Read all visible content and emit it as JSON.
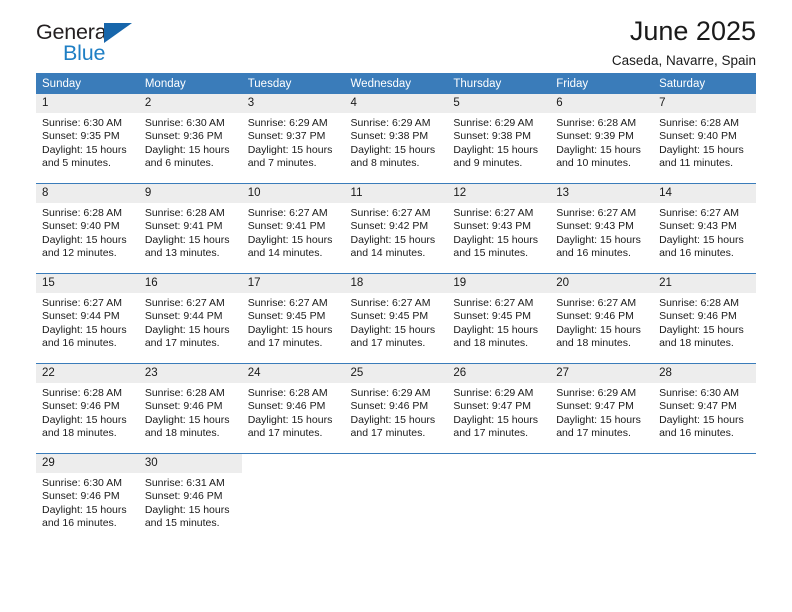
{
  "brand": {
    "name_part1": "General",
    "name_part2": "Blue",
    "triangle_color": "#1766ab",
    "blue_color": "#1f7fc4",
    "dark_color": "#231f20"
  },
  "header": {
    "title": "June 2025",
    "subtitle": "Caseda, Navarre, Spain",
    "accent_color": "#3a7cba",
    "daynum_background": "#ededed"
  },
  "weekday_headers": [
    "Sunday",
    "Monday",
    "Tuesday",
    "Wednesday",
    "Thursday",
    "Friday",
    "Saturday"
  ],
  "weeks": [
    [
      {
        "day": "1",
        "sunrise": "Sunrise: 6:30 AM",
        "sunset": "Sunset: 9:35 PM",
        "daylight_line1": "Daylight: 15 hours",
        "daylight_line2": "and 5 minutes."
      },
      {
        "day": "2",
        "sunrise": "Sunrise: 6:30 AM",
        "sunset": "Sunset: 9:36 PM",
        "daylight_line1": "Daylight: 15 hours",
        "daylight_line2": "and 6 minutes."
      },
      {
        "day": "3",
        "sunrise": "Sunrise: 6:29 AM",
        "sunset": "Sunset: 9:37 PM",
        "daylight_line1": "Daylight: 15 hours",
        "daylight_line2": "and 7 minutes."
      },
      {
        "day": "4",
        "sunrise": "Sunrise: 6:29 AM",
        "sunset": "Sunset: 9:38 PM",
        "daylight_line1": "Daylight: 15 hours",
        "daylight_line2": "and 8 minutes."
      },
      {
        "day": "5",
        "sunrise": "Sunrise: 6:29 AM",
        "sunset": "Sunset: 9:38 PM",
        "daylight_line1": "Daylight: 15 hours",
        "daylight_line2": "and 9 minutes."
      },
      {
        "day": "6",
        "sunrise": "Sunrise: 6:28 AM",
        "sunset": "Sunset: 9:39 PM",
        "daylight_line1": "Daylight: 15 hours",
        "daylight_line2": "and 10 minutes."
      },
      {
        "day": "7",
        "sunrise": "Sunrise: 6:28 AM",
        "sunset": "Sunset: 9:40 PM",
        "daylight_line1": "Daylight: 15 hours",
        "daylight_line2": "and 11 minutes."
      }
    ],
    [
      {
        "day": "8",
        "sunrise": "Sunrise: 6:28 AM",
        "sunset": "Sunset: 9:40 PM",
        "daylight_line1": "Daylight: 15 hours",
        "daylight_line2": "and 12 minutes."
      },
      {
        "day": "9",
        "sunrise": "Sunrise: 6:28 AM",
        "sunset": "Sunset: 9:41 PM",
        "daylight_line1": "Daylight: 15 hours",
        "daylight_line2": "and 13 minutes."
      },
      {
        "day": "10",
        "sunrise": "Sunrise: 6:27 AM",
        "sunset": "Sunset: 9:41 PM",
        "daylight_line1": "Daylight: 15 hours",
        "daylight_line2": "and 14 minutes."
      },
      {
        "day": "11",
        "sunrise": "Sunrise: 6:27 AM",
        "sunset": "Sunset: 9:42 PM",
        "daylight_line1": "Daylight: 15 hours",
        "daylight_line2": "and 14 minutes."
      },
      {
        "day": "12",
        "sunrise": "Sunrise: 6:27 AM",
        "sunset": "Sunset: 9:43 PM",
        "daylight_line1": "Daylight: 15 hours",
        "daylight_line2": "and 15 minutes."
      },
      {
        "day": "13",
        "sunrise": "Sunrise: 6:27 AM",
        "sunset": "Sunset: 9:43 PM",
        "daylight_line1": "Daylight: 15 hours",
        "daylight_line2": "and 16 minutes."
      },
      {
        "day": "14",
        "sunrise": "Sunrise: 6:27 AM",
        "sunset": "Sunset: 9:43 PM",
        "daylight_line1": "Daylight: 15 hours",
        "daylight_line2": "and 16 minutes."
      }
    ],
    [
      {
        "day": "15",
        "sunrise": "Sunrise: 6:27 AM",
        "sunset": "Sunset: 9:44 PM",
        "daylight_line1": "Daylight: 15 hours",
        "daylight_line2": "and 16 minutes."
      },
      {
        "day": "16",
        "sunrise": "Sunrise: 6:27 AM",
        "sunset": "Sunset: 9:44 PM",
        "daylight_line1": "Daylight: 15 hours",
        "daylight_line2": "and 17 minutes."
      },
      {
        "day": "17",
        "sunrise": "Sunrise: 6:27 AM",
        "sunset": "Sunset: 9:45 PM",
        "daylight_line1": "Daylight: 15 hours",
        "daylight_line2": "and 17 minutes."
      },
      {
        "day": "18",
        "sunrise": "Sunrise: 6:27 AM",
        "sunset": "Sunset: 9:45 PM",
        "daylight_line1": "Daylight: 15 hours",
        "daylight_line2": "and 17 minutes."
      },
      {
        "day": "19",
        "sunrise": "Sunrise: 6:27 AM",
        "sunset": "Sunset: 9:45 PM",
        "daylight_line1": "Daylight: 15 hours",
        "daylight_line2": "and 18 minutes."
      },
      {
        "day": "20",
        "sunrise": "Sunrise: 6:27 AM",
        "sunset": "Sunset: 9:46 PM",
        "daylight_line1": "Daylight: 15 hours",
        "daylight_line2": "and 18 minutes."
      },
      {
        "day": "21",
        "sunrise": "Sunrise: 6:28 AM",
        "sunset": "Sunset: 9:46 PM",
        "daylight_line1": "Daylight: 15 hours",
        "daylight_line2": "and 18 minutes."
      }
    ],
    [
      {
        "day": "22",
        "sunrise": "Sunrise: 6:28 AM",
        "sunset": "Sunset: 9:46 PM",
        "daylight_line1": "Daylight: 15 hours",
        "daylight_line2": "and 18 minutes."
      },
      {
        "day": "23",
        "sunrise": "Sunrise: 6:28 AM",
        "sunset": "Sunset: 9:46 PM",
        "daylight_line1": "Daylight: 15 hours",
        "daylight_line2": "and 18 minutes."
      },
      {
        "day": "24",
        "sunrise": "Sunrise: 6:28 AM",
        "sunset": "Sunset: 9:46 PM",
        "daylight_line1": "Daylight: 15 hours",
        "daylight_line2": "and 17 minutes."
      },
      {
        "day": "25",
        "sunrise": "Sunrise: 6:29 AM",
        "sunset": "Sunset: 9:46 PM",
        "daylight_line1": "Daylight: 15 hours",
        "daylight_line2": "and 17 minutes."
      },
      {
        "day": "26",
        "sunrise": "Sunrise: 6:29 AM",
        "sunset": "Sunset: 9:47 PM",
        "daylight_line1": "Daylight: 15 hours",
        "daylight_line2": "and 17 minutes."
      },
      {
        "day": "27",
        "sunrise": "Sunrise: 6:29 AM",
        "sunset": "Sunset: 9:47 PM",
        "daylight_line1": "Daylight: 15 hours",
        "daylight_line2": "and 17 minutes."
      },
      {
        "day": "28",
        "sunrise": "Sunrise: 6:30 AM",
        "sunset": "Sunset: 9:47 PM",
        "daylight_line1": "Daylight: 15 hours",
        "daylight_line2": "and 16 minutes."
      }
    ],
    [
      {
        "day": "29",
        "sunrise": "Sunrise: 6:30 AM",
        "sunset": "Sunset: 9:46 PM",
        "daylight_line1": "Daylight: 15 hours",
        "daylight_line2": "and 16 minutes."
      },
      {
        "day": "30",
        "sunrise": "Sunrise: 6:31 AM",
        "sunset": "Sunset: 9:46 PM",
        "daylight_line1": "Daylight: 15 hours",
        "daylight_line2": "and 15 minutes."
      },
      {
        "day": "",
        "sunrise": "",
        "sunset": "",
        "daylight_line1": "",
        "daylight_line2": ""
      },
      {
        "day": "",
        "sunrise": "",
        "sunset": "",
        "daylight_line1": "",
        "daylight_line2": ""
      },
      {
        "day": "",
        "sunrise": "",
        "sunset": "",
        "daylight_line1": "",
        "daylight_line2": ""
      },
      {
        "day": "",
        "sunrise": "",
        "sunset": "",
        "daylight_line1": "",
        "daylight_line2": ""
      },
      {
        "day": "",
        "sunrise": "",
        "sunset": "",
        "daylight_line1": "",
        "daylight_line2": ""
      }
    ]
  ]
}
